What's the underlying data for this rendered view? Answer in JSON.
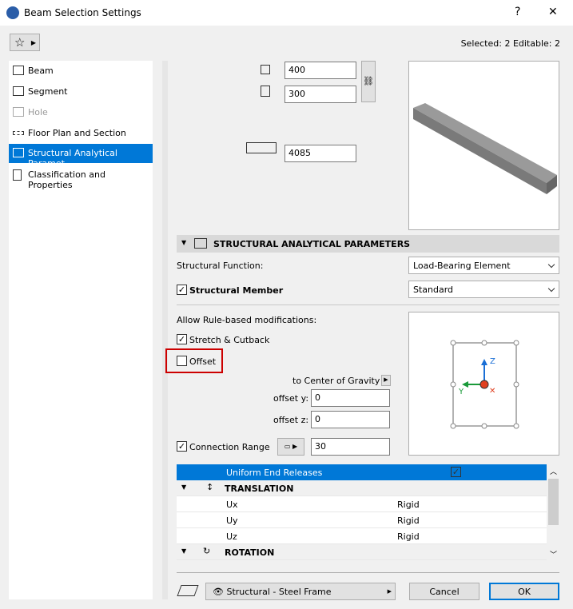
{
  "window": {
    "title": "Beam Selection Settings",
    "help": "?",
    "close": "✕"
  },
  "header": {
    "selection_info": "Selected: 2 Editable: 2"
  },
  "sidebar": {
    "items": [
      {
        "label": "Beam",
        "icon": "beam-icon"
      },
      {
        "label": "Segment",
        "icon": "segment-icon"
      },
      {
        "label": "Hole",
        "icon": "hole-icon",
        "disabled": true
      },
      {
        "label": "Floor Plan and Section",
        "icon": "floor-plan-icon"
      },
      {
        "label": "Structural Analytical Paramet...",
        "icon": "structural-icon",
        "selected": true
      },
      {
        "label": "Classification and Properties",
        "icon": "classification-icon"
      }
    ]
  },
  "geometry": {
    "height": "400",
    "width": "300",
    "length": "4085"
  },
  "section": {
    "title": "STRUCTURAL ANALYTICAL PARAMETERS"
  },
  "structural_function": {
    "label": "Structural Function:",
    "value": "Load-Bearing Element"
  },
  "structural_member": {
    "label": "Structural Member",
    "checked": true,
    "value": "Standard"
  },
  "rules": {
    "label": "Allow Rule-based modifications:",
    "stretch": "Stretch & Cutback",
    "offset": "Offset"
  },
  "offset": {
    "reference": "to Center of Gravity",
    "y_label": "offset y:",
    "y_value": "0",
    "z_label": "offset z:",
    "z_value": "0"
  },
  "connection": {
    "label": "Connection Range",
    "value": "30"
  },
  "diagram": {
    "z": "Z",
    "y": "Y",
    "x": "✕"
  },
  "releases": {
    "header": "Uniform End Releases",
    "translation": "TRANSLATION",
    "rotation": "ROTATION",
    "rows": [
      {
        "name": "Ux",
        "value": "Rigid"
      },
      {
        "name": "Uy",
        "value": "Rigid"
      },
      {
        "name": "Uz",
        "value": "Rigid"
      }
    ]
  },
  "footer": {
    "layer": "Structural - Steel Frame",
    "cancel": "Cancel",
    "ok": "OK"
  },
  "colors": {
    "accent": "#0078d7",
    "highlight": "#cc0000"
  }
}
